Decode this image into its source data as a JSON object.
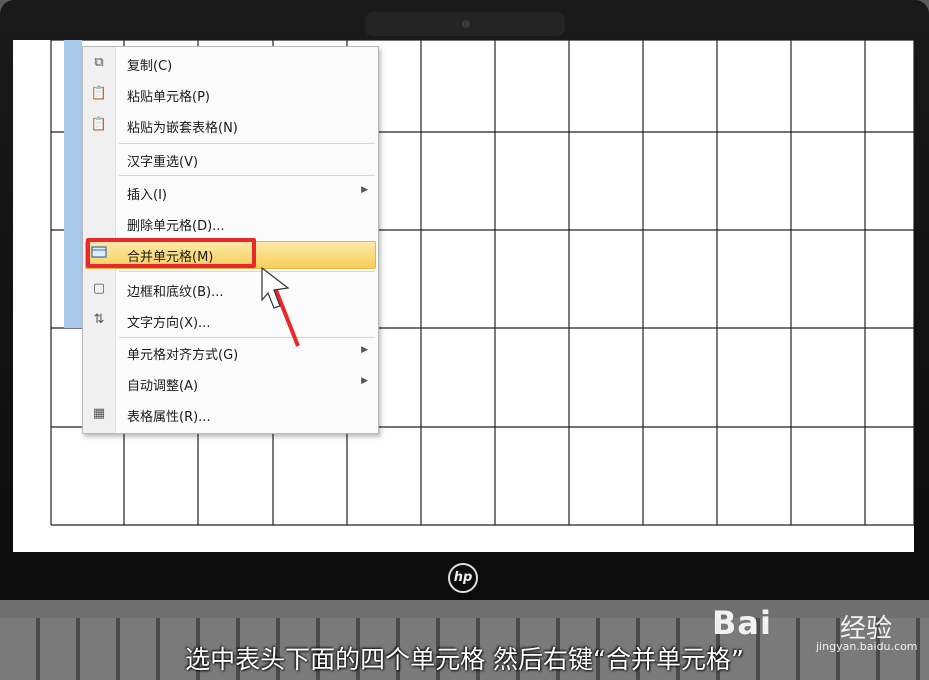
{
  "context_menu": {
    "items": [
      {
        "label": "复制(C)",
        "icon": "copy-icon"
      },
      {
        "label": "粘贴单元格(P)",
        "icon": "paste-icon"
      },
      {
        "label": "粘贴为嵌套表格(N)",
        "icon": "paste-nested-icon"
      },
      {
        "label": "汉字重选(V)",
        "icon": ""
      },
      {
        "label": "插入(I)",
        "icon": "",
        "submenu": true
      },
      {
        "label": "删除单元格(D)...",
        "icon": ""
      },
      {
        "label": "合并单元格(M)",
        "icon": "merge-cells-icon",
        "highlighted": true
      },
      {
        "label": "边框和底纹(B)...",
        "icon": "borders-icon"
      },
      {
        "label": "文字方向(X)...",
        "icon": "text-direction-icon"
      },
      {
        "label": "单元格对齐方式(G)",
        "icon": "",
        "submenu": true
      },
      {
        "label": "自动调整(A)",
        "icon": "",
        "submenu": true
      },
      {
        "label": "表格属性(R)...",
        "icon": "table-properties-icon"
      }
    ]
  },
  "laptop": {
    "brand": "hp"
  },
  "watermark": {
    "brand": "Bai",
    "suffix": "经验",
    "url": "jingyan.baidu.com"
  },
  "caption": "选中表头下面的四个单元格 然后右键“合并单元格”",
  "colors": {
    "highlight": "#f8cf5b",
    "annotation_red": "#e8282d",
    "selection_blue": "#a8c8ec"
  }
}
